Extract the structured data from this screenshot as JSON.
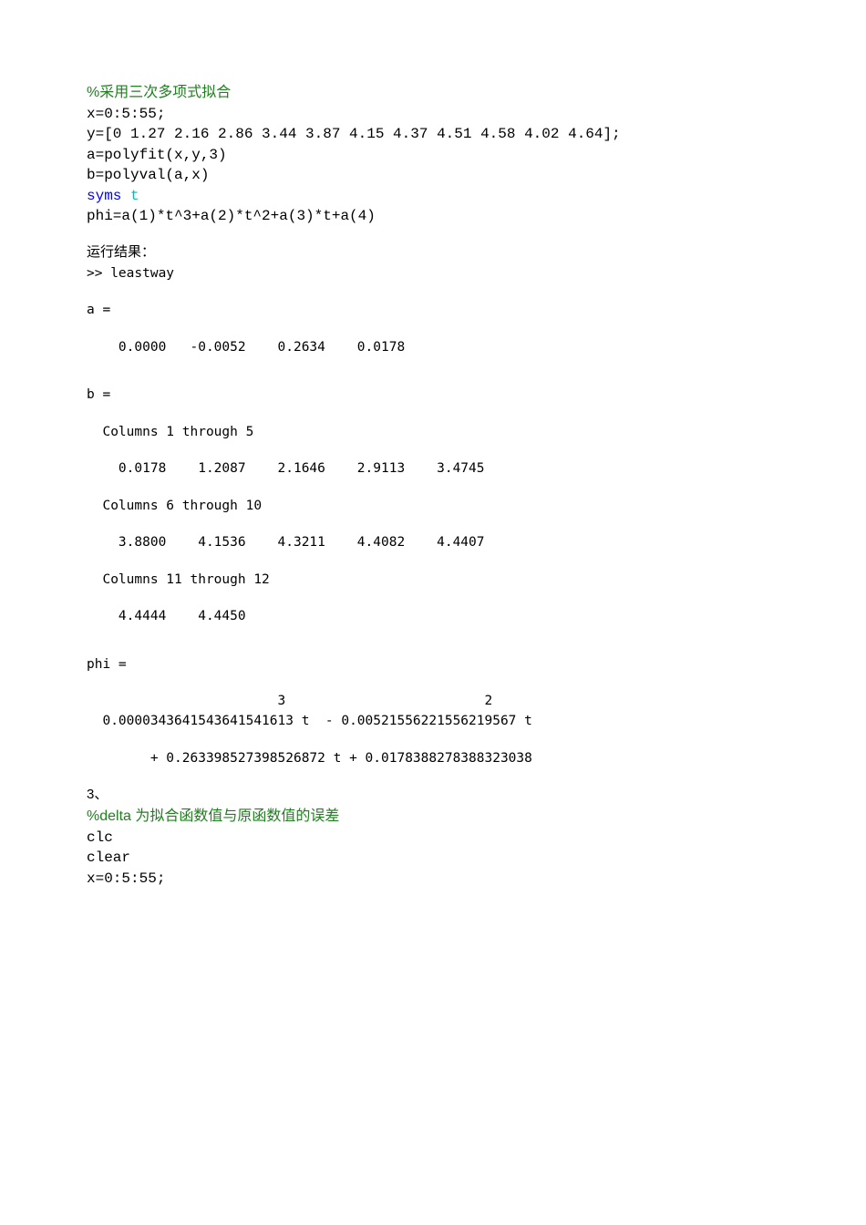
{
  "section1": {
    "comment": "%采用三次多项式拟合",
    "code_lines": [
      "x=0:5:55;",
      "y=[0 1.27 2.16 2.86 3.44 3.87 4.15 4.37 4.51 4.58 4.02 4.64];",
      "a=polyfit(x,y,3)",
      "b=polyval(a,x)",
      "syms t",
      "phi=a(1)*t^3+a(2)*t^2+a(3)*t+a(4)"
    ],
    "syms_keyword": "syms ",
    "syms_var": "t"
  },
  "output": {
    "heading": "运行结果：",
    "prompt": ">> leastway",
    "a_label": "a =",
    "a_values": "    0.0000   -0.0052    0.2634    0.0178",
    "b_label": "b =",
    "b_col_1_5": "  Columns 1 through 5",
    "b_vals_1_5": "    0.0178    1.2087    2.1646    2.9113    3.4745",
    "b_col_6_10": "  Columns 6 through 10",
    "b_vals_6_10": "    3.8800    4.1536    4.3211    4.4082    4.4407",
    "b_col_11_12": "  Columns 11 through 12",
    "b_vals_11_12": "    4.4444    4.4450",
    "phi_label": "phi =",
    "phi_exp_line": "                        3                         2",
    "phi_line1": "  0.0000343641543641541613 t  - 0.00521556221556219567 t",
    "phi_line2": "        + 0.263398527398526872 t + 0.0178388278388323038"
  },
  "section3": {
    "number": "3、",
    "comment": "%delta 为拟合函数值与原函数值的误差",
    "code_lines": [
      "clc",
      "clear",
      "x=0:5:55;"
    ]
  }
}
